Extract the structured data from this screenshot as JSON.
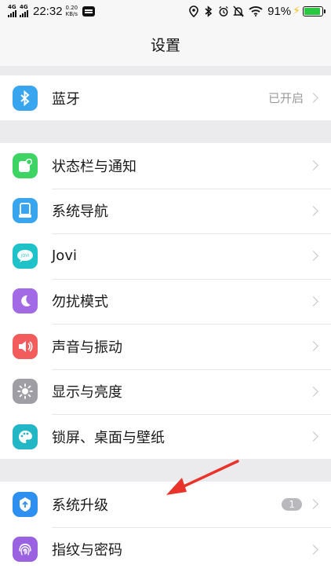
{
  "status_bar": {
    "net1": "4G",
    "net2": "4G",
    "time": "22:32",
    "speed_value": "0.20",
    "speed_unit": "KB/s",
    "battery": "91%",
    "battery_level": 0.91,
    "icons": [
      "message-icon",
      "location-icon",
      "bluetooth-icon",
      "alarm-icon",
      "mute-icon",
      "wifi-icon",
      "charging-icon",
      "battery-icon"
    ]
  },
  "header": {
    "title": "设置"
  },
  "groups": [
    {
      "items": [
        {
          "label": "蓝牙",
          "value": "已开启",
          "icon": "bluetooth-icon",
          "color": "#3aa5ef"
        }
      ]
    },
    {
      "items": [
        {
          "label": "状态栏与通知",
          "icon": "status-bar-icon",
          "color": "#3ed464"
        },
        {
          "label": "系统导航",
          "icon": "navigation-icon",
          "color": "#3aa5ef"
        },
        {
          "label": "Jovi",
          "icon": "jovi-icon",
          "color": "#1fc2c8"
        },
        {
          "label": "勿扰模式",
          "icon": "moon-icon",
          "color": "#a36ae6"
        },
        {
          "label": "声音与振动",
          "icon": "speaker-icon",
          "color": "#f25c5c"
        },
        {
          "label": "显示与亮度",
          "icon": "brightness-icon",
          "color": "#9e9ea4"
        },
        {
          "label": "锁屏、桌面与壁纸",
          "icon": "palette-icon",
          "color": "#23b7c5"
        }
      ]
    },
    {
      "items": [
        {
          "label": "系统升级",
          "badge": "1",
          "icon": "upgrade-icon",
          "color": "#2d8ff0"
        },
        {
          "label": "指纹与密码",
          "icon": "fingerprint-icon",
          "color": "#9a62e0"
        }
      ]
    }
  ],
  "annotation": {
    "type": "arrow",
    "color": "#e8342b"
  }
}
